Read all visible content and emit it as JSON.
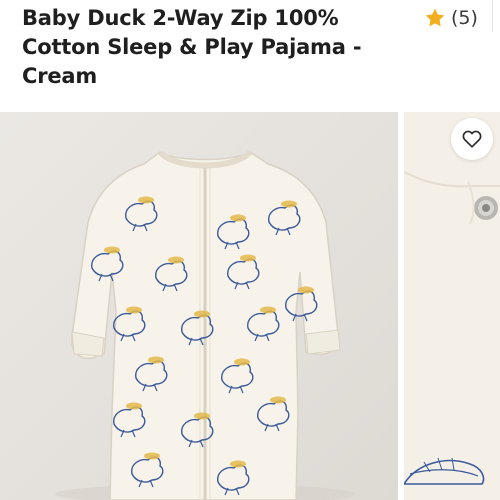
{
  "product": {
    "title": "Baby Duck 2-Way Zip 100% Cotton Sleep & Play Pajama - Cream",
    "rating_count": "(5)"
  },
  "icons": {
    "rating": "star-icon",
    "favorite": "heart-outline-icon"
  },
  "colors": {
    "star": "#f2b01e",
    "pajama": "#f7f3ea",
    "duck_print": "#3b5a9a",
    "duck_hat": "#e4b84a"
  }
}
